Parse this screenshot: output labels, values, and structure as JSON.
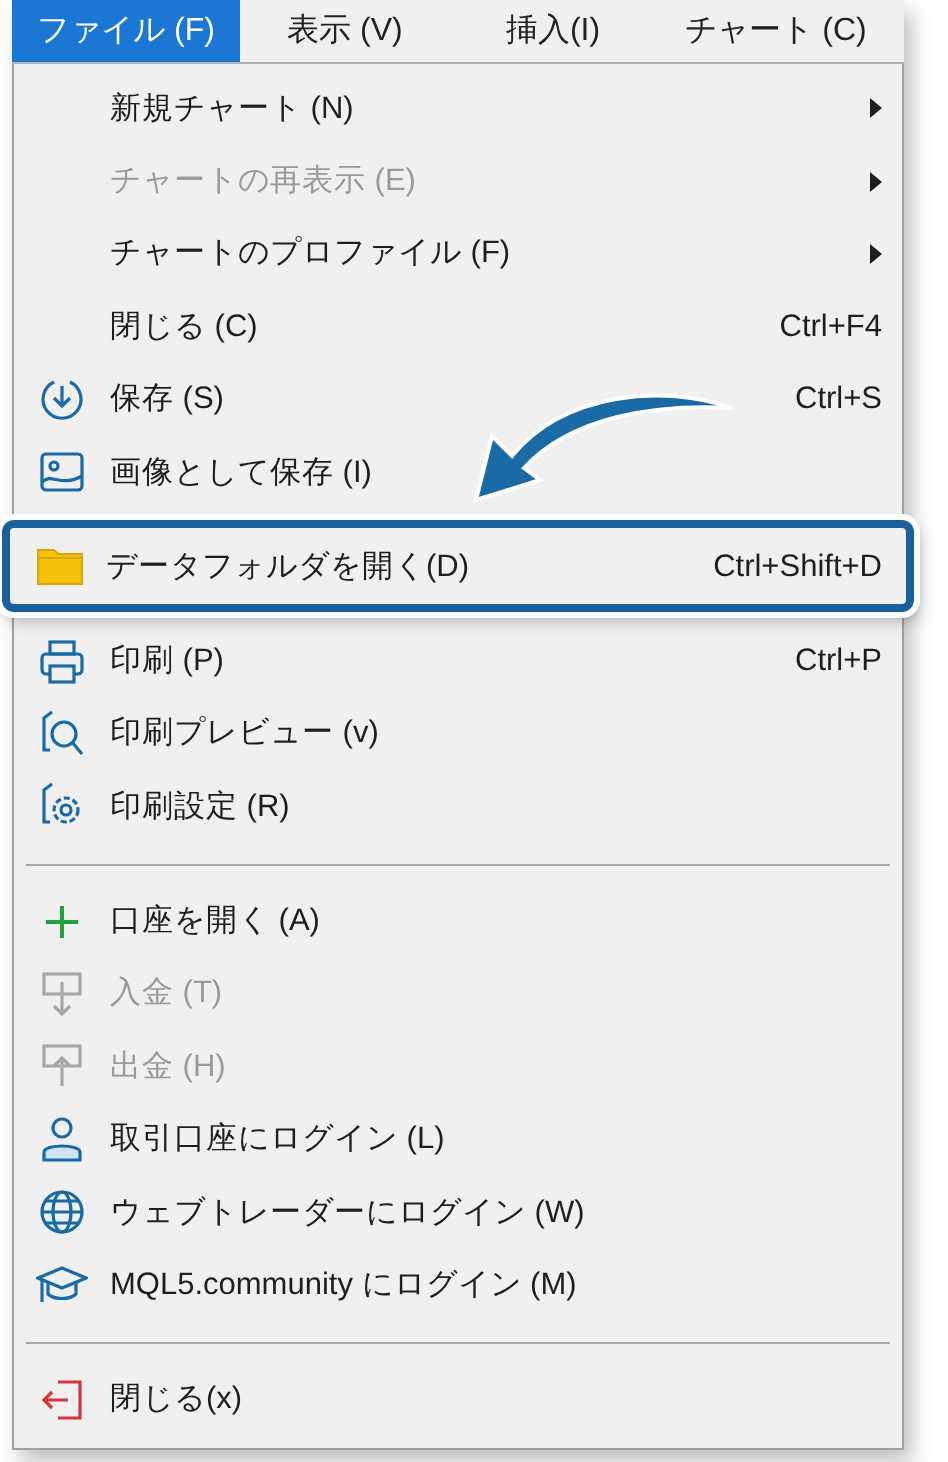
{
  "menu_bar": [
    {
      "label": "ファイル (F)",
      "selected": true
    },
    {
      "label": "表示 (V)",
      "selected": false
    },
    {
      "label": "挿入(I)",
      "selected": false
    },
    {
      "label": "チャート (C)",
      "selected": false
    }
  ],
  "menu": [
    {
      "kind": "item",
      "label": "新規チャート (N)",
      "disabled": false,
      "submenu": true,
      "highlighted": false
    },
    {
      "kind": "item",
      "label": "チャートの再表示 (E)",
      "disabled": true,
      "submenu": true,
      "highlighted": false
    },
    {
      "kind": "item",
      "label": "チャートのプロファイル (F)",
      "disabled": false,
      "submenu": true,
      "highlighted": false
    },
    {
      "kind": "item",
      "label": "閉じる (C)",
      "shortcut": "Ctrl+F4",
      "disabled": false,
      "submenu": false,
      "highlighted": false
    },
    {
      "kind": "item",
      "label": "保存 (S)",
      "shortcut": "Ctrl+S",
      "disabled": false,
      "submenu": false,
      "highlighted": false
    },
    {
      "kind": "item",
      "label": "画像として保存 (I)",
      "disabled": false,
      "submenu": false,
      "highlighted": false
    },
    {
      "kind": "item",
      "label": "データフォルダを開く(D)",
      "shortcut": "Ctrl+Shift+D",
      "disabled": false,
      "submenu": false,
      "highlighted": true
    },
    {
      "kind": "item",
      "label": "印刷 (P)",
      "shortcut": "Ctrl+P",
      "disabled": false,
      "submenu": false,
      "highlighted": false
    },
    {
      "kind": "item",
      "label": "印刷プレビュー (v)",
      "disabled": false,
      "submenu": false,
      "highlighted": false
    },
    {
      "kind": "item",
      "label": "印刷設定 (R)",
      "disabled": false,
      "submenu": false,
      "highlighted": false
    },
    {
      "kind": "separator"
    },
    {
      "kind": "item",
      "label": "口座を開く (A)",
      "disabled": false,
      "submenu": false,
      "highlighted": false
    },
    {
      "kind": "item",
      "label": "入金 (T)",
      "disabled": true,
      "submenu": false,
      "highlighted": false
    },
    {
      "kind": "item",
      "label": "出金 (H)",
      "disabled": true,
      "submenu": false,
      "highlighted": false
    },
    {
      "kind": "item",
      "label": "取引口座にログイン (L)",
      "disabled": false,
      "submenu": false,
      "highlighted": false
    },
    {
      "kind": "item",
      "label": "ウェブトレーダーにログイン (W)",
      "disabled": false,
      "submenu": false,
      "highlighted": false
    },
    {
      "kind": "item",
      "label": "MQL5.community にログイン (M)",
      "disabled": false,
      "submenu": false,
      "highlighted": false
    },
    {
      "kind": "separator"
    },
    {
      "kind": "item",
      "label": "閉じる(x)",
      "disabled": false,
      "submenu": false,
      "highlighted": false
    }
  ]
}
